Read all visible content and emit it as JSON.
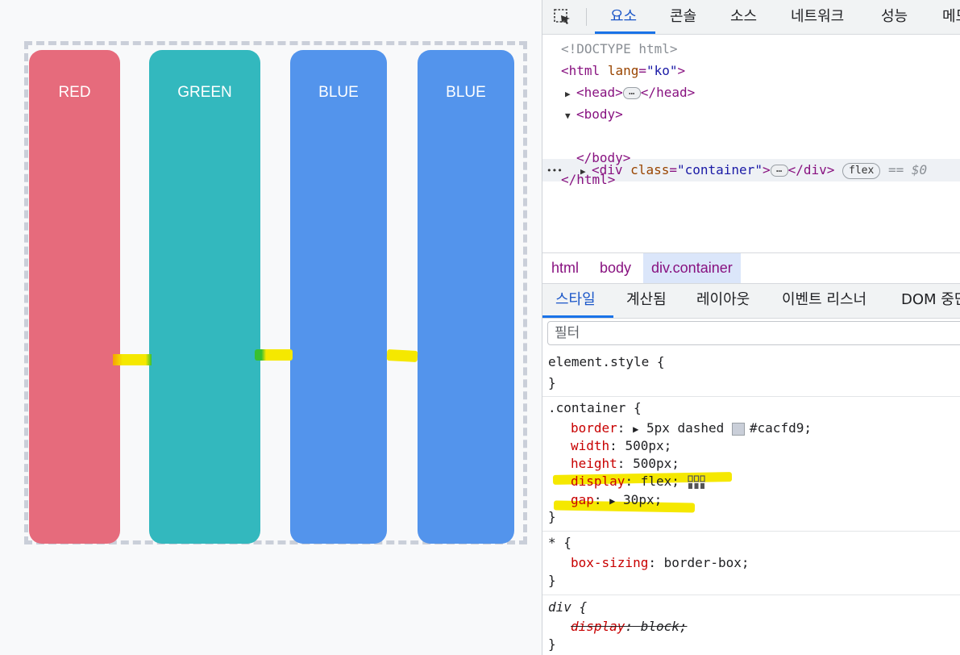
{
  "preview": {
    "items": [
      {
        "label": "RED",
        "color": "#e66b7c"
      },
      {
        "label": "GREEN",
        "color": "#33b8be"
      },
      {
        "label": "BLUE",
        "color": "#5394ec"
      },
      {
        "label": "BLUE",
        "color": "#5394ec"
      }
    ]
  },
  "devtools": {
    "tabs": [
      "요소",
      "콘솔",
      "소스",
      "네트워크",
      "성능",
      "메모"
    ],
    "dom": {
      "doctype": "<!DOCTYPE html>",
      "html_open_tag": "<html",
      "html_attr": "lang",
      "html_attr_eq": "=",
      "html_attr_val": "\"ko\"",
      "html_open_close": ">",
      "head_open": "<head>",
      "ellipsis": "…",
      "head_close": "</head>",
      "body_open": "<body>",
      "div_open": "<div",
      "div_attr": "class",
      "div_attr_val": "\"container\"",
      "div_open_close": ">",
      "div_close": "</div>",
      "badge": "flex",
      "selected_marker": "== $0",
      "row_dots": "•••",
      "body_close": "</body>",
      "html_close": "</html>"
    },
    "breadcrumbs": [
      "html",
      "body",
      "div.container"
    ],
    "subtabs": [
      "스타일",
      "계산됨",
      "레이아웃",
      "이벤트 리스너",
      "DOM 중단"
    ],
    "filter_placeholder": "필터",
    "styles": {
      "element_style": "element.style",
      "open_brace": "{",
      "close_brace": "}",
      "container_selector": ".container",
      "container_props": [
        {
          "name": "border",
          "value": "5px dashed",
          "color": "#cacfd9"
        },
        {
          "name": "width",
          "value": "500px"
        },
        {
          "name": "height",
          "value": "500px"
        },
        {
          "name": "display",
          "value": "flex"
        },
        {
          "name": "gap",
          "value": "30px"
        }
      ],
      "universal_selector": "*",
      "universal_props": [
        {
          "name": "box-sizing",
          "value": "border-box"
        }
      ],
      "div_selector": "div",
      "div_props": [
        {
          "name": "display",
          "value": "block"
        }
      ]
    }
  }
}
